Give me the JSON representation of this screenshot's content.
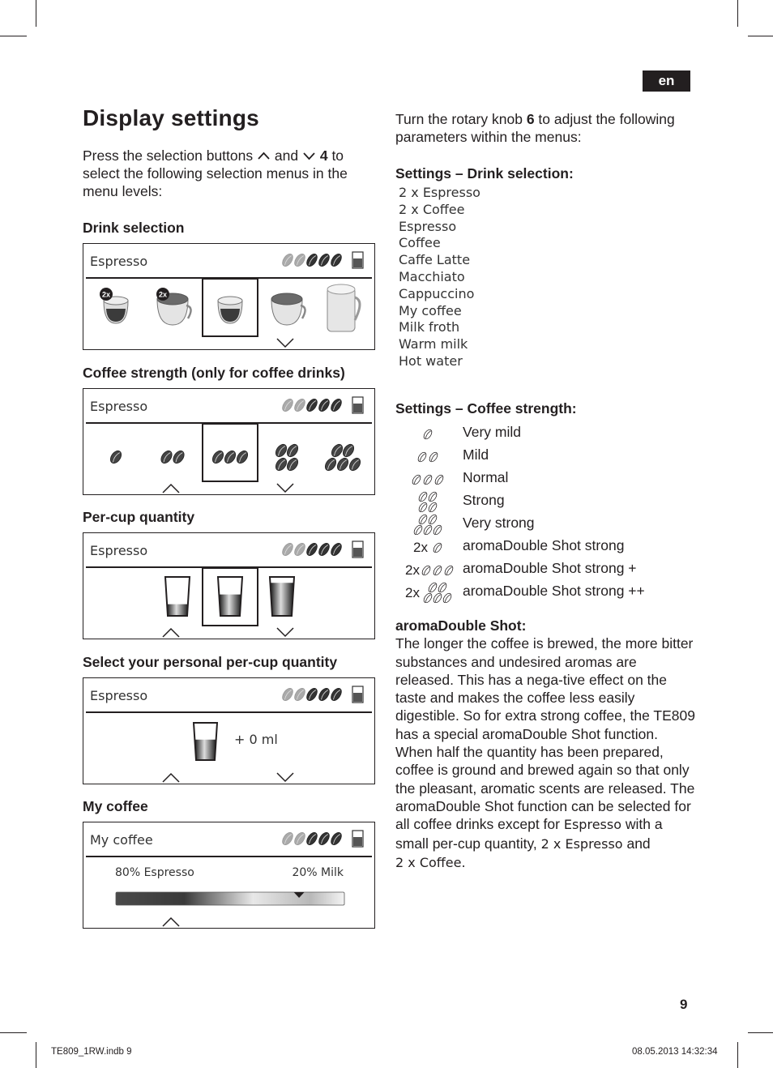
{
  "language_badge": "en",
  "page_title": "Display settings",
  "intro": {
    "before": "Press the selection buttons",
    "and": "and",
    "button_number": "4",
    "after": "to select the following selection menus in the menu levels:"
  },
  "sections": {
    "drink_selection": "Drink selection",
    "coffee_strength": "Coffee strength (only for coffee drinks)",
    "per_cup": "Per-cup quantity",
    "personal_quantity": "Select your personal per-cup quantity",
    "my_coffee": "My coffee"
  },
  "panels": {
    "drink": {
      "title": "Espresso",
      "drinks": [
        "2x Espresso",
        "2x Coffee",
        "Espresso",
        "Coffee",
        "Caffe Latte"
      ],
      "selected_index": 2,
      "badge": "2x"
    },
    "strength": {
      "title": "Espresso",
      "levels": [
        1,
        2,
        3,
        4,
        5
      ],
      "selected_index": 2
    },
    "cup": {
      "title": "Espresso",
      "fill_levels": [
        0.3,
        0.55,
        0.85
      ],
      "selected_index": 1
    },
    "personal": {
      "title": "Espresso",
      "value": "+ 0 ml"
    },
    "mycoffee": {
      "title": "My coffee",
      "left_label": "80% Espresso",
      "right_label": "20% Milk",
      "espresso_percent": 80
    }
  },
  "status_indicator": {
    "strength_active_beans": 3,
    "total_beans": 5
  },
  "right": {
    "intro_before": "Turn the rotary knob",
    "knob_number": "6",
    "intro_after": "to adjust the following parameters within the menus:",
    "drink_heading": "Settings – Drink selection:",
    "drink_list": [
      "2 x Espresso",
      "2 x Coffee",
      "Espresso",
      "Coffee",
      "Caffe Latte",
      "Macchiato",
      "Cappuccino",
      "My coffee",
      "Milk froth",
      "Warm milk",
      "Hot water"
    ],
    "strength_heading": "Settings – Coffee strength:",
    "strength_list": [
      {
        "prefix": "",
        "beans": 1,
        "label": "Very mild"
      },
      {
        "prefix": "",
        "beans": 2,
        "label": "Mild"
      },
      {
        "prefix": "",
        "beans": 3,
        "label": "Normal"
      },
      {
        "prefix": "",
        "beans": 4,
        "label": "Strong"
      },
      {
        "prefix": "",
        "beans": 5,
        "label": "Very strong"
      },
      {
        "prefix": "2x",
        "beans": 1,
        "label": "aromaDouble Shot strong"
      },
      {
        "prefix": "2x",
        "beans": 3,
        "label": "aromaDouble Shot strong +"
      },
      {
        "prefix": "2x",
        "beans": 5,
        "label": "aromaDouble Shot strong ++"
      }
    ],
    "aroma_heading": "aromaDouble Shot:",
    "aroma_text": "The longer the coffee is brewed, the more bitter substances and undesired aromas are released. This has a nega-tive effect on the taste and makes the coffee less easily digestible. So for extra strong coffee, the TE809 has a special aromaDouble Shot function. When half the quantity has been prepared, coffee is ground and brewed again so that only the pleasant, aromatic scents are released. The aromaDouble Shot function can be selected for all coffee drinks except for",
    "aroma_espresso": "Espresso",
    "aroma_mid": "with a small per-cup quantity,",
    "aroma_2xesp": "2 x Espresso",
    "aroma_and": "and",
    "aroma_2xcof": "2 x Coffee."
  },
  "page_number": "9",
  "footer": {
    "file": "TE809_1RW.indb   9",
    "timestamp": "08.05.2013   14:32:34"
  }
}
